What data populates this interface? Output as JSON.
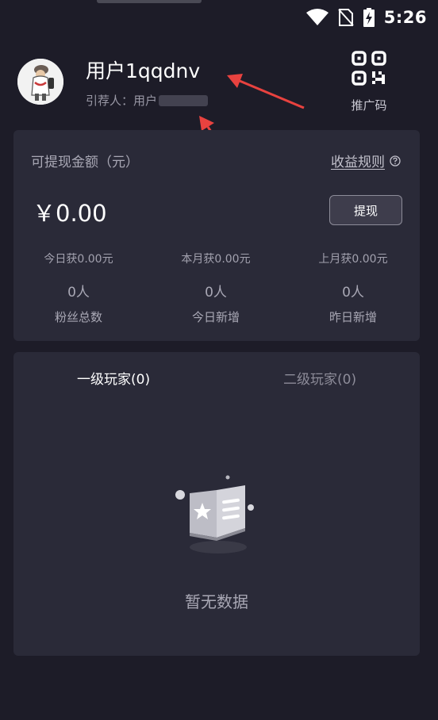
{
  "status_bar": {
    "time": "5:26"
  },
  "profile": {
    "username": "用户1qqdnv",
    "referrer_label": "引荐人：用户",
    "qr_label": "推广码"
  },
  "earnings": {
    "withdrawable_title": "可提现金额（元）",
    "rules_link": "收益规则",
    "balance": "￥0.00",
    "withdraw_button": "提现",
    "stats": [
      {
        "earn": "今日获0.00元",
        "count": "0人",
        "label": "粉丝总数"
      },
      {
        "earn": "本月获0.00元",
        "count": "0人",
        "label": "今日新增"
      },
      {
        "earn": "上月获0.00元",
        "count": "0人",
        "label": "昨日新增"
      }
    ]
  },
  "players": {
    "tabs": [
      "一级玩家(0)",
      "二级玩家(0)"
    ],
    "empty_text": "暂无数据"
  },
  "colors": {
    "background": "#1d1c28",
    "card": "#2a2a38",
    "annotation_arrow": "#e8423f"
  }
}
